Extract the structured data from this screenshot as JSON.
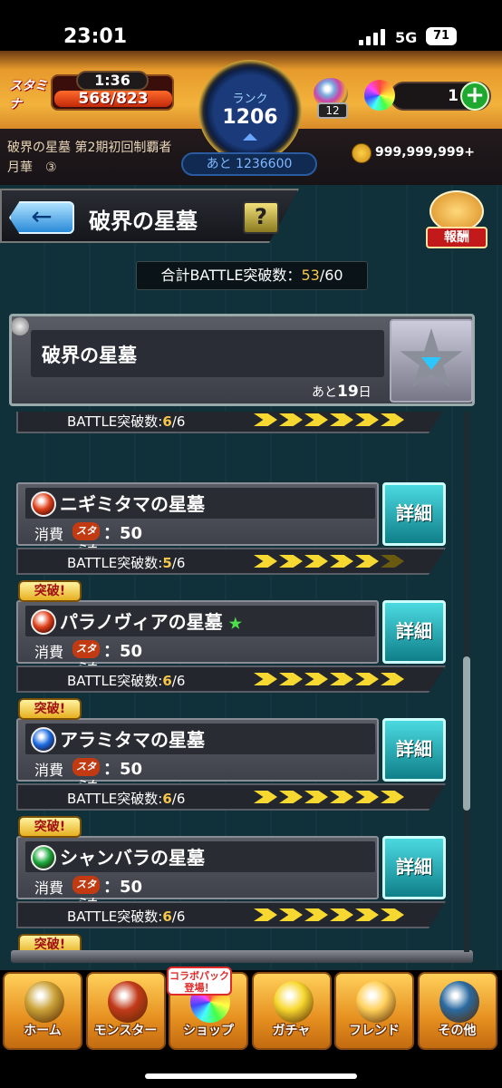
{
  "status_bar": {
    "time": "23:01",
    "network": "5G",
    "battery": "71"
  },
  "header": {
    "stamina_label": "スタミナ",
    "stamina_timer": "1:36",
    "stamina_value": "568/823",
    "rank_label": "ランク",
    "rank_value": "1206",
    "rank_remaining": "あと 1236600",
    "egg_count": "12",
    "orb_count": "1",
    "plus_label": "+",
    "quest_title": "破界の星墓 第2期初回制覇者",
    "player_name": "月華　③",
    "gold": "999,999,999+"
  },
  "page": {
    "back_label": "←",
    "title": "破界の星墓",
    "help_label": "?",
    "reward_label": "報酬",
    "total_label": "合計BATTLE突破数：",
    "total_current": "53",
    "total_max": "/60"
  },
  "event": {
    "title": "破界の星墓",
    "days_prefix": "あと",
    "days_value": "19",
    "days_suffix": "日"
  },
  "cards_common": {
    "cost_label": "消費",
    "stamina_icon": "スタミナ",
    "cost_value": "：50",
    "detail_label": "詳細",
    "progress_label": "BATTLE突破数:",
    "cleared_badge": "突破!"
  },
  "cards": [
    {
      "title": "",
      "element": "",
      "cleared": "6",
      "total": "/6",
      "badge": false
    },
    {
      "title": "ニギミタマの星墓",
      "element": "fire",
      "cleared": "5",
      "total": "/6",
      "badge": false
    },
    {
      "title": "パラノヴィアの星墓",
      "element": "fire",
      "cleared": "6",
      "total": "/6",
      "badge": true,
      "star": "★"
    },
    {
      "title": "アラミタマの星墓",
      "element": "water",
      "cleared": "6",
      "total": "/6",
      "badge": true
    },
    {
      "title": "シャンバラの星墓",
      "element": "wood",
      "cleared": "6",
      "total": "/6",
      "badge": true
    }
  ],
  "bottom_nav": {
    "collab_label": "コラボパック登場！",
    "items": [
      {
        "label": "ホーム",
        "icon": "home-icon"
      },
      {
        "label": "モンスター",
        "icon": "monster-icon"
      },
      {
        "label": "ショップ",
        "icon": "shop-icon"
      },
      {
        "label": "ガチャ",
        "icon": "gacha-icon"
      },
      {
        "label": "フレンド",
        "icon": "friend-icon"
      },
      {
        "label": "その他",
        "icon": "other-icon"
      }
    ]
  },
  "colors": {
    "accent": "#f7c64a",
    "detail": "#1fb0bb",
    "fire": "#e0401a",
    "water": "#1a6ae0",
    "wood": "#1aa83a"
  }
}
